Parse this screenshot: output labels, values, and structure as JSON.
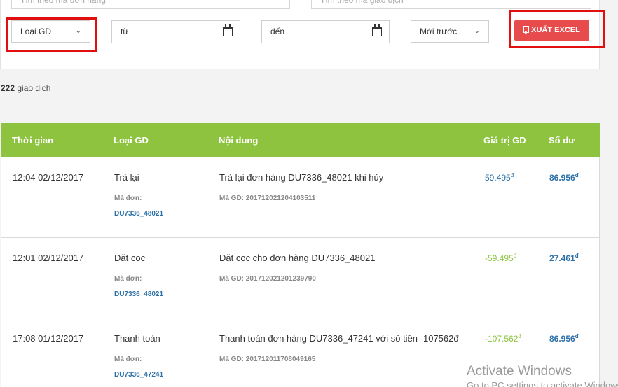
{
  "filters": {
    "search_order_placeholder": "Tìm theo mã đơn hàng",
    "search_gd_placeholder": "Tìm theo mã giao dịch",
    "type_select": "Loại GD",
    "date_from": "từ",
    "date_to": "đến",
    "sort_select": "Mới trước",
    "export_label": "XUẤT EXCEL"
  },
  "summary": {
    "count": "222",
    "count_label": "giao dịch"
  },
  "table": {
    "headers": {
      "time": "Thời gian",
      "type": "Loại GD",
      "content": "Nội dung",
      "value": "Giá trị GD",
      "balance": "Số dư"
    },
    "order_label": "Mã đơn:",
    "currency": "đ",
    "rows": [
      {
        "time": "12:04 02/12/2017",
        "type": "Trả lại",
        "order": "DU7336_48021",
        "content": "Trả lại đơn hàng DU7336_48021 khi hủy",
        "gd": "Mã GD: 201712021204103511",
        "value": "59.495",
        "balance": "86.956"
      },
      {
        "time": "12:01 02/12/2017",
        "type": "Đặt cọc",
        "order": "DU7336_48021",
        "content": "Đặt cọc cho đơn hàng DU7336_48021",
        "gd": "Mã GD: 201712021201239790",
        "value": "-59.495",
        "balance": "27.461"
      },
      {
        "time": "17:08 01/12/2017",
        "type": "Thanh toán",
        "order": "DU7336_47241",
        "content": "Thanh toán đơn hàng DU7336_47241 với số tiền -107562đ",
        "gd": "Mã GD: 201712011708049165",
        "value": "-107.562",
        "balance": "86.956"
      }
    ]
  },
  "watermark": {
    "title": "Activate Windows",
    "subtitle": "Go to PC settings to activate Windows."
  },
  "colors": {
    "header_green": "#8dc33f",
    "export_red": "#e84b4b",
    "highlight_red": "#e20f0f",
    "link_blue": "#2a6fa8"
  }
}
